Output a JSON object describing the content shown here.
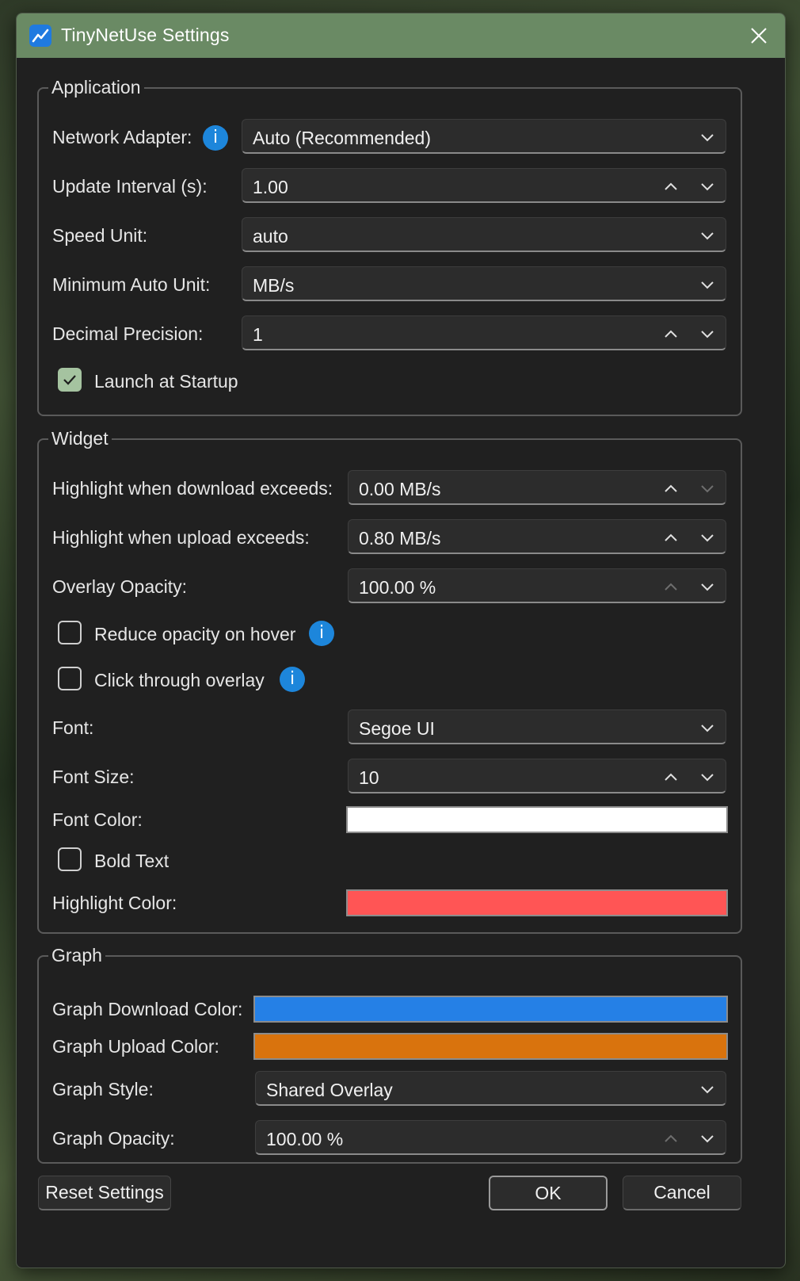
{
  "window": {
    "title": "TinyNetUse Settings",
    "app_icon": "chart-line-icon",
    "close_icon": "close-icon"
  },
  "application": {
    "title": "Application",
    "network_adapter": {
      "label": "Network Adapter:",
      "value": "Auto (Recommended)"
    },
    "update_interval": {
      "label": "Update Interval (s):",
      "value": "1.00"
    },
    "speed_unit": {
      "label": "Speed Unit:",
      "value": "auto"
    },
    "min_auto_unit": {
      "label": "Minimum Auto Unit:",
      "value": "MB/s"
    },
    "decimal_precision": {
      "label": "Decimal Precision:",
      "value": "1"
    },
    "launch_at_startup": {
      "label": "Launch at Startup",
      "checked": true
    }
  },
  "widget": {
    "title": "Widget",
    "download_threshold": {
      "label": "Highlight when download exceeds:",
      "value": "0.00 MB/s"
    },
    "upload_threshold": {
      "label": "Highlight when upload exceeds:",
      "value": "0.80 MB/s"
    },
    "overlay_opacity": {
      "label": "Overlay Opacity:",
      "value": "100.00 %"
    },
    "reduce_opacity_hover": {
      "label": "Reduce opacity on hover",
      "checked": false
    },
    "click_through": {
      "label": "Click through overlay",
      "checked": false
    },
    "font": {
      "label": "Font:",
      "value": "Segoe UI"
    },
    "font_size": {
      "label": "Font Size:",
      "value": "10"
    },
    "font_color": {
      "label": "Font Color:",
      "color": "#ffffff"
    },
    "bold_text": {
      "label": "Bold Text",
      "checked": false
    },
    "highlight_color": {
      "label": "Highlight Color:",
      "color": "#ff5555"
    }
  },
  "graph": {
    "title": "Graph",
    "download_color": {
      "label": "Graph Download Color:",
      "color": "#2580e6"
    },
    "upload_color": {
      "label": "Graph Upload Color:",
      "color": "#d9730d"
    },
    "style": {
      "label": "Graph Style:",
      "value": "Shared Overlay"
    },
    "opacity": {
      "label": "Graph Opacity:",
      "value": "100.00 %"
    }
  },
  "buttons": {
    "reset": "Reset Settings",
    "ok": "OK",
    "cancel": "Cancel"
  }
}
